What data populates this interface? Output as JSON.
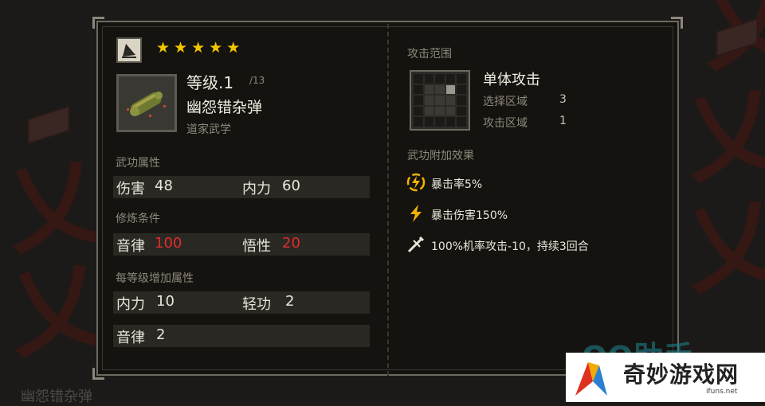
{
  "stars": [
    "★",
    "★",
    "★",
    "★",
    "★"
  ],
  "item": {
    "level_label": "等级.1",
    "level_max": "/13",
    "name": "幽怨错杂弹",
    "school": "道家武学"
  },
  "sections": {
    "attributes": "武功属性",
    "requirements": "修炼条件",
    "per_level": "每等级增加属性"
  },
  "attributes": [
    {
      "label": "伤害",
      "value": "48"
    },
    {
      "label": "内力",
      "value": "60"
    }
  ],
  "requirements": [
    {
      "label": "音律",
      "value": "100"
    },
    {
      "label": "悟性",
      "value": "20"
    }
  ],
  "per_level": [
    {
      "label": "内力",
      "value": "10"
    },
    {
      "label": "轻功",
      "value": "2"
    },
    {
      "label": "音律",
      "value": "2"
    }
  ],
  "range": {
    "section_label": "攻击范围",
    "title": "单体攻击",
    "select_label": "选择区域",
    "select_value": "3",
    "attack_label": "攻击区域",
    "attack_value": "1"
  },
  "effects": {
    "section_label": "武功附加效果",
    "items": [
      {
        "icon": "crit-rate-icon",
        "text": "暴击率5%"
      },
      {
        "icon": "lightning-icon",
        "text": "暴击伤害150%"
      },
      {
        "icon": "crossed-swords-icon",
        "text": "100%机率攻击-10，持续3回合"
      }
    ]
  },
  "background_label": "幽怨错杂弹",
  "watermark": {
    "partial": "QQ助手",
    "brand": "奇妙游戏网",
    "url": "ifuns.net"
  },
  "colors": {
    "star": "#f2c500",
    "requirement_value": "#e02c2c",
    "effect_icon": "#f2b200"
  }
}
